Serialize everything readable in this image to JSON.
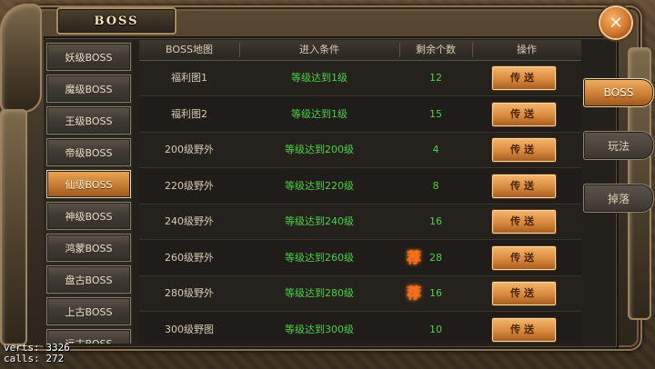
{
  "window": {
    "title": "BOSS"
  },
  "close_icon": "close-x-icon",
  "menu": {
    "items": [
      {
        "label": "妖级BOSS",
        "active": false
      },
      {
        "label": "魔级BOSS",
        "active": false
      },
      {
        "label": "王级BOSS",
        "active": false
      },
      {
        "label": "帝级BOSS",
        "active": false
      },
      {
        "label": "仙级BOSS",
        "active": true
      },
      {
        "label": "神级BOSS",
        "active": false
      },
      {
        "label": "鸿蒙BOSS",
        "active": false
      },
      {
        "label": "盘古BOSS",
        "active": false
      },
      {
        "label": "上古BOSS",
        "active": false
      },
      {
        "label": "远古BOSS",
        "active": false
      }
    ]
  },
  "table": {
    "headers": [
      "BOSS地图",
      "进入条件",
      "剩余个数",
      "操作"
    ],
    "rows": [
      {
        "map": "福利图1",
        "condition": "等级达到1级",
        "count": "12",
        "recommended": false,
        "action": "传送"
      },
      {
        "map": "福利图2",
        "condition": "等级达到1级",
        "count": "15",
        "recommended": false,
        "action": "传送"
      },
      {
        "map": "200级野外",
        "condition": "等级达到200级",
        "count": "4",
        "recommended": false,
        "action": "传送"
      },
      {
        "map": "220级野外",
        "condition": "等级达到220级",
        "count": "8",
        "recommended": false,
        "action": "传送"
      },
      {
        "map": "240级野外",
        "condition": "等级达到240级",
        "count": "16",
        "recommended": false,
        "action": "传送"
      },
      {
        "map": "260级野外",
        "condition": "等级达到260级",
        "count": "28",
        "recommended": true,
        "action": "传送"
      },
      {
        "map": "280级野外",
        "condition": "等级达到280级",
        "count": "16",
        "recommended": true,
        "action": "传送"
      },
      {
        "map": "300级野图",
        "condition": "等级达到300级",
        "count": "10",
        "recommended": false,
        "action": "传送"
      }
    ],
    "recommend_glyph": "荐"
  },
  "tabs": [
    {
      "label": "BOSS",
      "active": true
    },
    {
      "label": "玩法",
      "active": false
    },
    {
      "label": "掉落",
      "active": false
    }
  ],
  "debug": {
    "verts_label": "verts:",
    "verts_value": "3326",
    "calls_label": "calls:",
    "calls_value": "272"
  },
  "colors": {
    "accent_orange": "#d9893e",
    "condition_green": "#4bd243",
    "frame_gold": "#a88c5e"
  }
}
